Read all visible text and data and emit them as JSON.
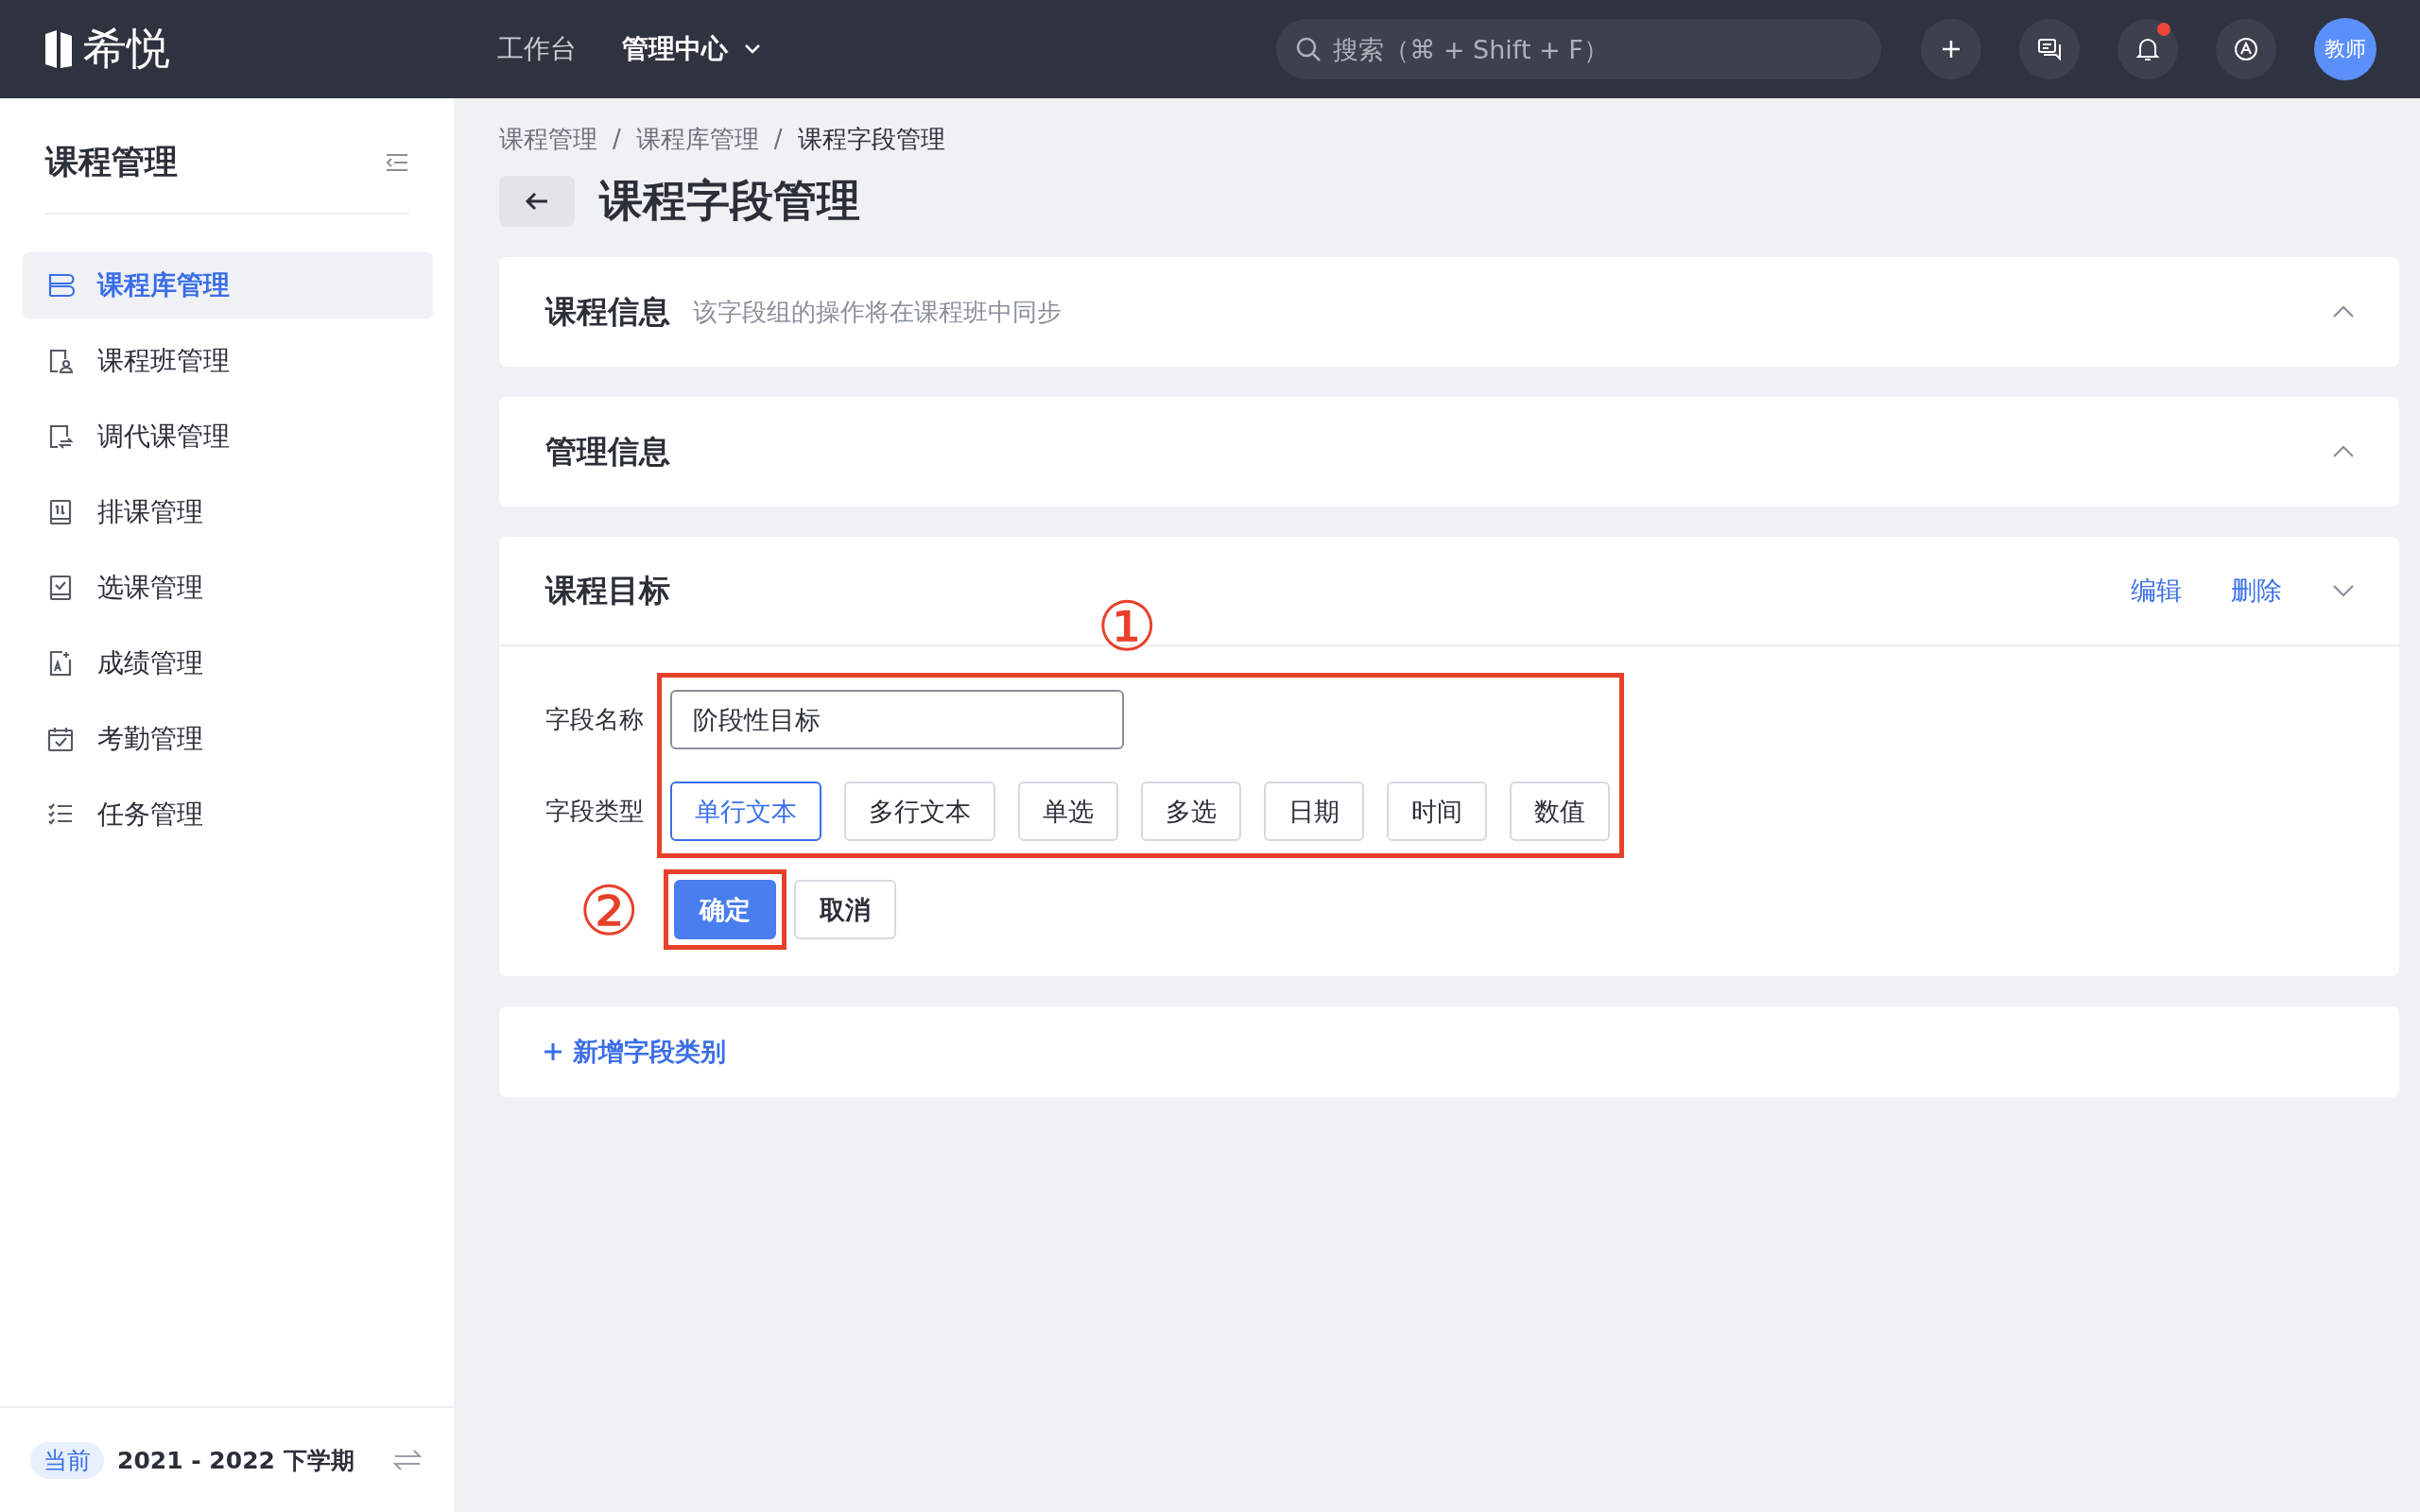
{
  "topbar": {
    "logo": "希悦",
    "nav": [
      {
        "label": "工作台",
        "selected": false,
        "dropdown": false
      },
      {
        "label": "管理中心",
        "selected": true,
        "dropdown": true
      }
    ],
    "search": {
      "placeholder": "搜索（⌘ + Shift + F）"
    },
    "notification_dot": true,
    "avatar": "教师"
  },
  "sidebar": {
    "title": "课程管理",
    "items": [
      {
        "label": "课程库管理",
        "selected": true
      },
      {
        "label": "课程班管理",
        "selected": false
      },
      {
        "label": "调代课管理",
        "selected": false
      },
      {
        "label": "排课管理",
        "selected": false
      },
      {
        "label": "选课管理",
        "selected": false
      },
      {
        "label": "成绩管理",
        "selected": false
      },
      {
        "label": "考勤管理",
        "selected": false
      },
      {
        "label": "任务管理",
        "selected": false
      }
    ],
    "footer": {
      "badge": "当前",
      "term": "2021 - 2022 下学期"
    }
  },
  "breadcrumb": {
    "separator": "/",
    "items": [
      "课程管理",
      "课程库管理",
      "课程字段管理"
    ]
  },
  "page_title": "课程字段管理",
  "sections": [
    {
      "title": "课程信息",
      "subtitle": "该字段组的操作将在课程班中同步",
      "expanded": false
    },
    {
      "title": "管理信息",
      "expanded": false
    },
    {
      "title": "课程目标",
      "expanded": true,
      "actions": [
        "编辑",
        "删除"
      ],
      "form": {
        "name_label": "字段名称",
        "name_value": "阶段性目标",
        "type_label": "字段类型",
        "types": [
          {
            "label": "单行文本",
            "selected": true
          },
          {
            "label": "多行文本",
            "selected": false
          },
          {
            "label": "单选",
            "selected": false
          },
          {
            "label": "多选",
            "selected": false
          },
          {
            "label": "日期",
            "selected": false
          },
          {
            "label": "时间",
            "selected": false
          },
          {
            "label": "数值",
            "selected": false
          }
        ],
        "confirm": "确定",
        "cancel": "取消",
        "annotations": [
          "①",
          "②"
        ]
      }
    }
  ],
  "add_button": "新增字段类别"
}
